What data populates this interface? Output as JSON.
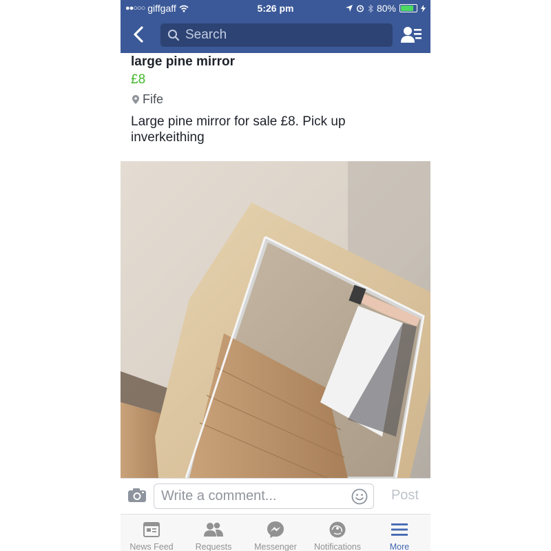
{
  "status_bar": {
    "carrier": "giffgaff",
    "time": "5:26 pm",
    "battery": "80%",
    "battery_level": 0.8
  },
  "nav": {
    "search_placeholder": "Search"
  },
  "listing": {
    "title": "large pine mirror",
    "price": "£8",
    "location": "Fife",
    "description": "Large pine mirror for sale £8. Pick up inverkeithing"
  },
  "comment": {
    "placeholder": "Write a comment...",
    "post_label": "Post"
  },
  "tabs": [
    {
      "label": "News Feed",
      "icon": "news-feed-icon"
    },
    {
      "label": "Requests",
      "icon": "requests-icon"
    },
    {
      "label": "Messenger",
      "icon": "messenger-icon"
    },
    {
      "label": "Notifications",
      "icon": "notifications-icon"
    },
    {
      "label": "More",
      "icon": "more-icon"
    }
  ],
  "colors": {
    "brand": "#3b5998",
    "price": "#42b72a",
    "active_tab": "#4267b2"
  }
}
